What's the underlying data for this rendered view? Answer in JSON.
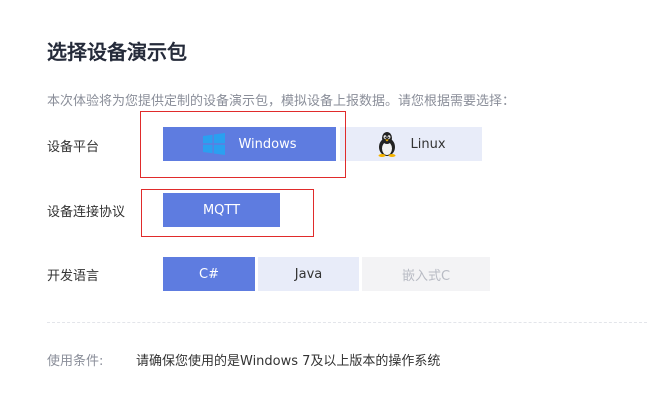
{
  "title": "选择设备演示包",
  "description": "本次体验将为您提供定制的设备演示包，模拟设备上报数据。请您根据需要选择：",
  "platform": {
    "label": "设备平台",
    "options": [
      "Windows",
      "Linux"
    ],
    "selected": "Windows"
  },
  "protocol": {
    "label": "设备连接协议",
    "options": [
      "MQTT"
    ],
    "selected": "MQTT"
  },
  "language": {
    "label": "开发语言",
    "options": [
      "C#",
      "Java",
      "嵌入式C"
    ],
    "selected": "C#",
    "disabled": [
      "嵌入式C"
    ]
  },
  "conditions": {
    "label": "使用条件:",
    "text": "请确保您使用的是Windows 7及以上版本的操作系统"
  },
  "colors": {
    "selected": "#5e7ce0",
    "unselected": "#e8ecf9",
    "highlight_box": "#e02b2b"
  },
  "icons": {
    "windows": "windows-logo-icon",
    "linux": "linux-tux-icon"
  }
}
